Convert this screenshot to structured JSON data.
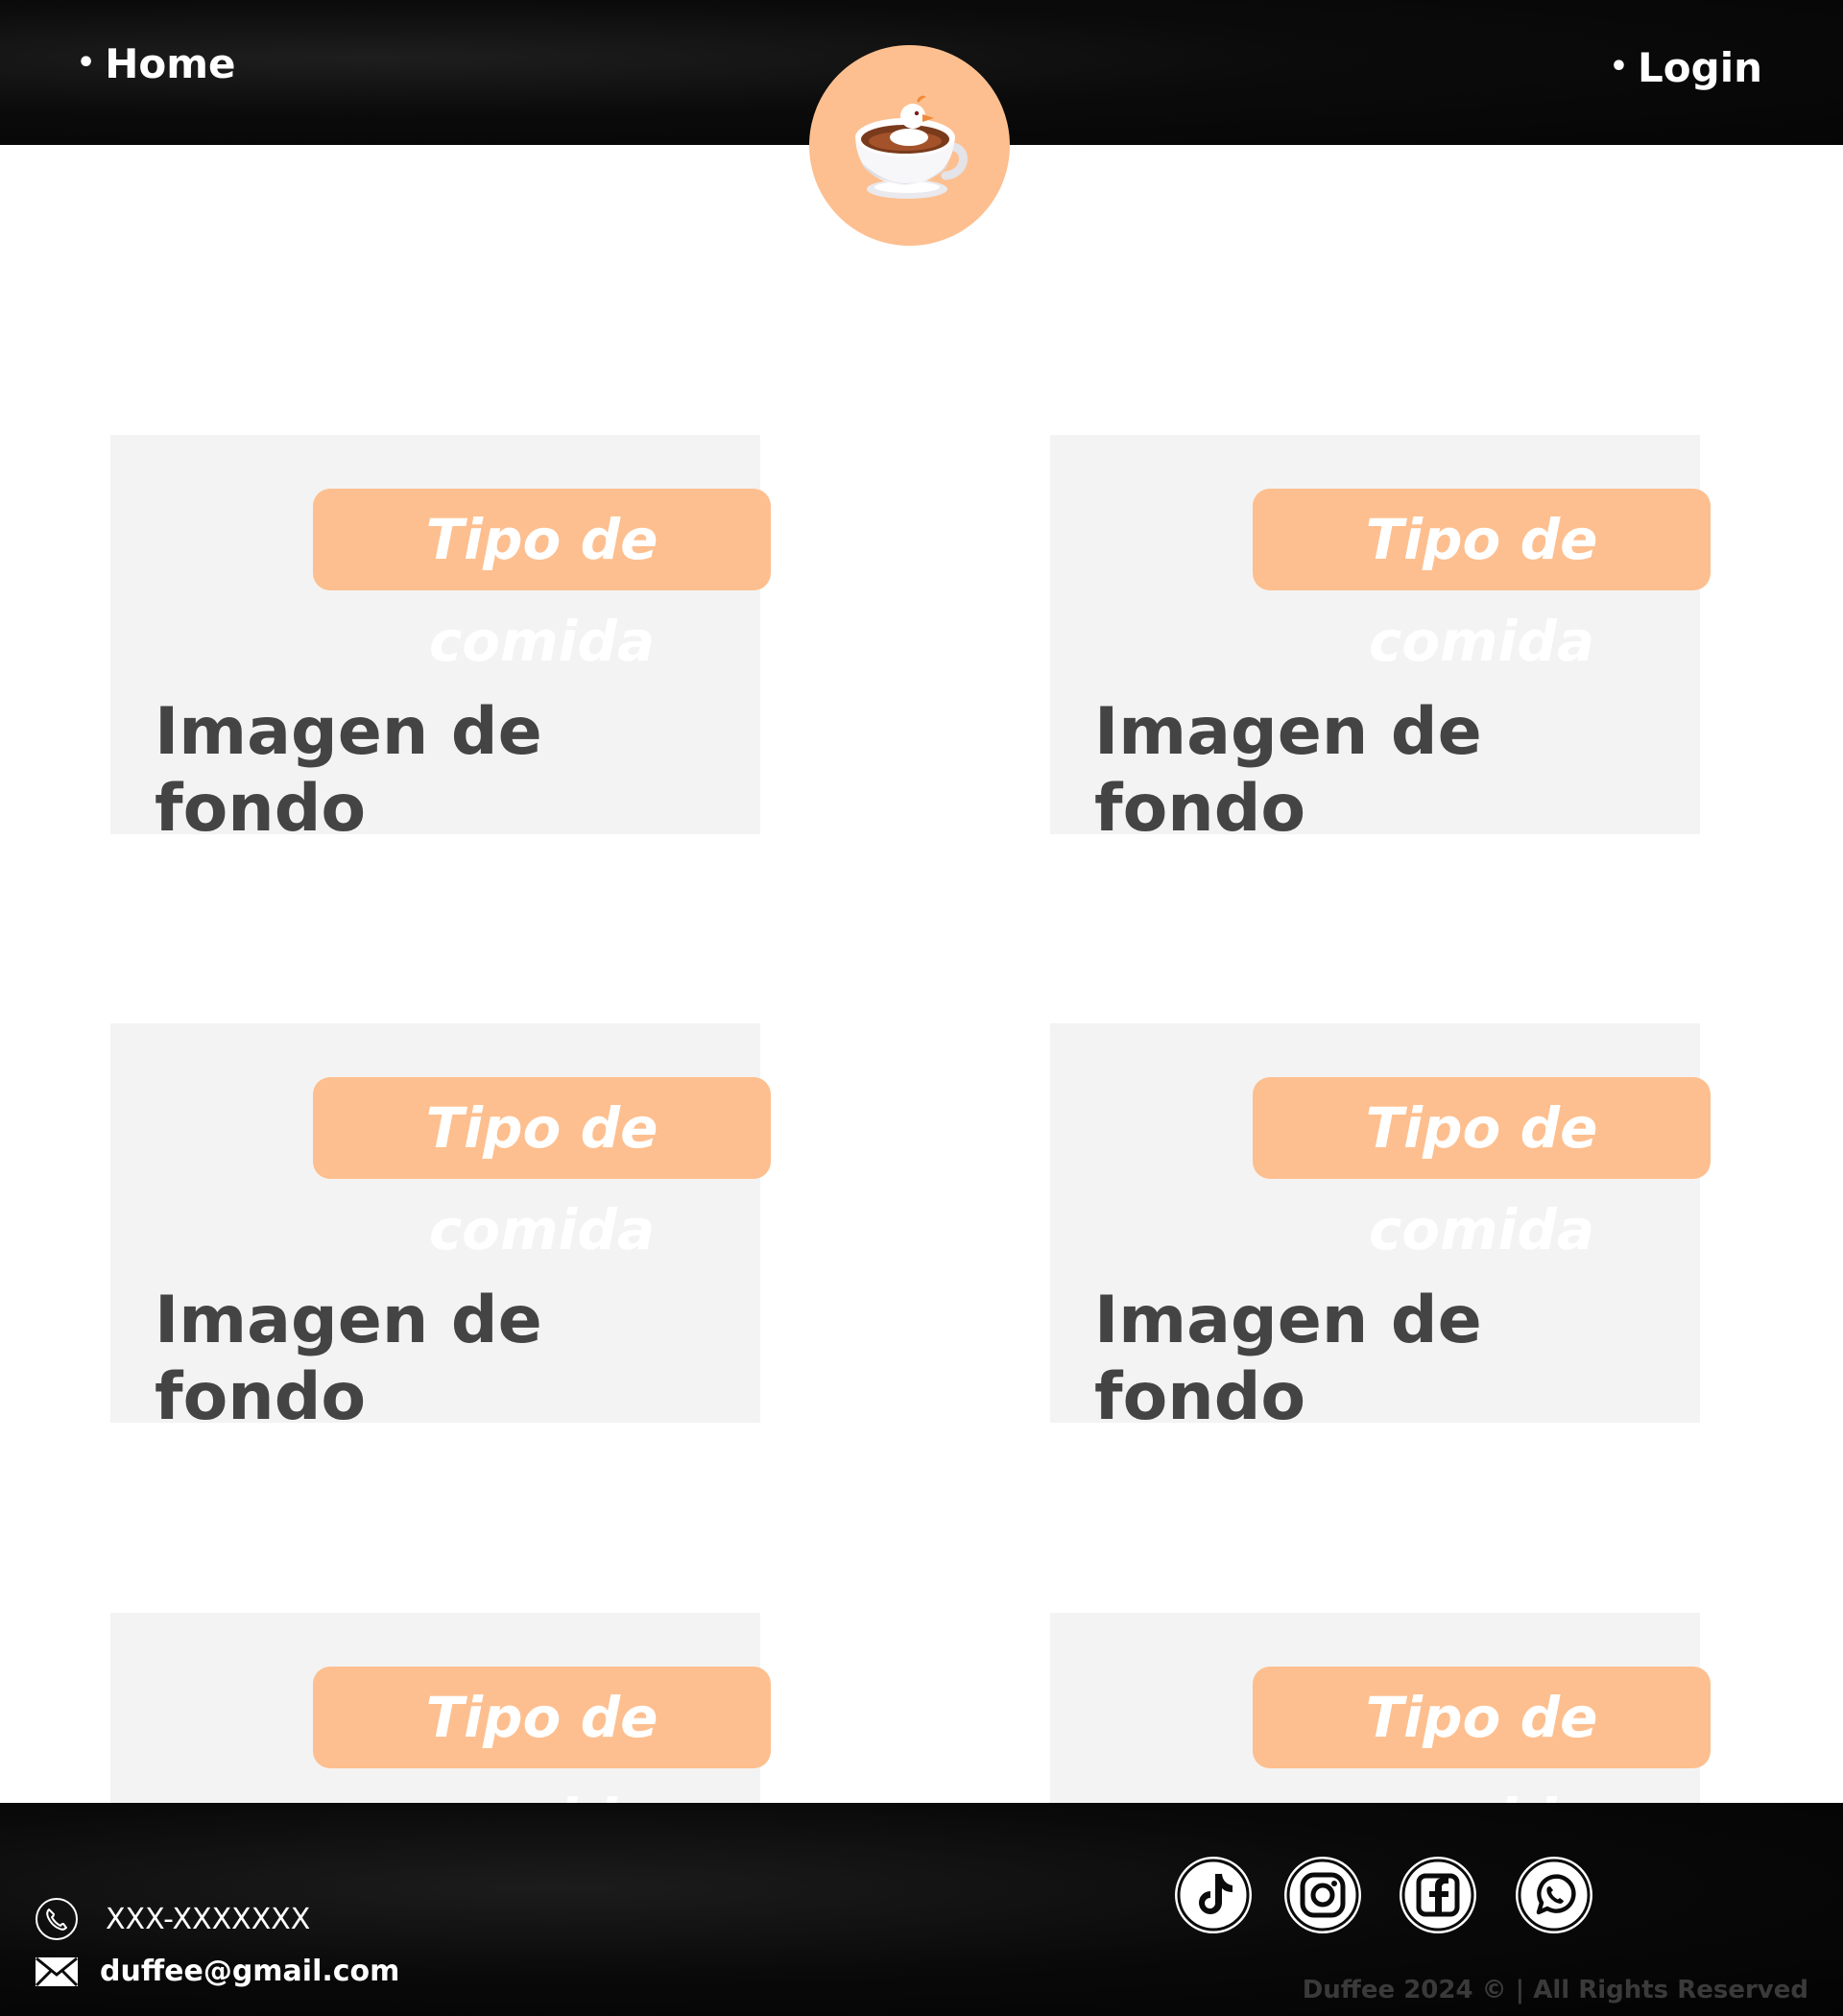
{
  "nav": {
    "bullet": "•",
    "home_label": "Home",
    "login_label": "Login"
  },
  "logo": {
    "icon": "duck-coffee-cup-icon",
    "color": "#fdbf8f"
  },
  "cards": [
    {
      "tag": "Tipo de comida",
      "caption": "Imagen de fondo"
    },
    {
      "tag": "Tipo de comida",
      "caption": "Imagen de fondo"
    },
    {
      "tag": "Tipo de comida",
      "caption": "Imagen de fondo"
    },
    {
      "tag": "Tipo de comida",
      "caption": "Imagen de fondo"
    },
    {
      "tag": "Tipo de comida",
      "caption": ""
    },
    {
      "tag": "Tipo de comida",
      "caption": ""
    }
  ],
  "footer": {
    "phone": "XXX-XXXXXXX",
    "email": "duffee@gmail.com",
    "copyright": "Duffee 2024 © | All Rights Reserved",
    "social": [
      "tiktok-icon",
      "instagram-icon",
      "facebook-icon",
      "whatsapp-icon"
    ]
  },
  "colors": {
    "accent": "#fdbf8f",
    "card_bg": "#f3f3f3",
    "caption": "#444444",
    "bar": "#0b0b0b"
  }
}
